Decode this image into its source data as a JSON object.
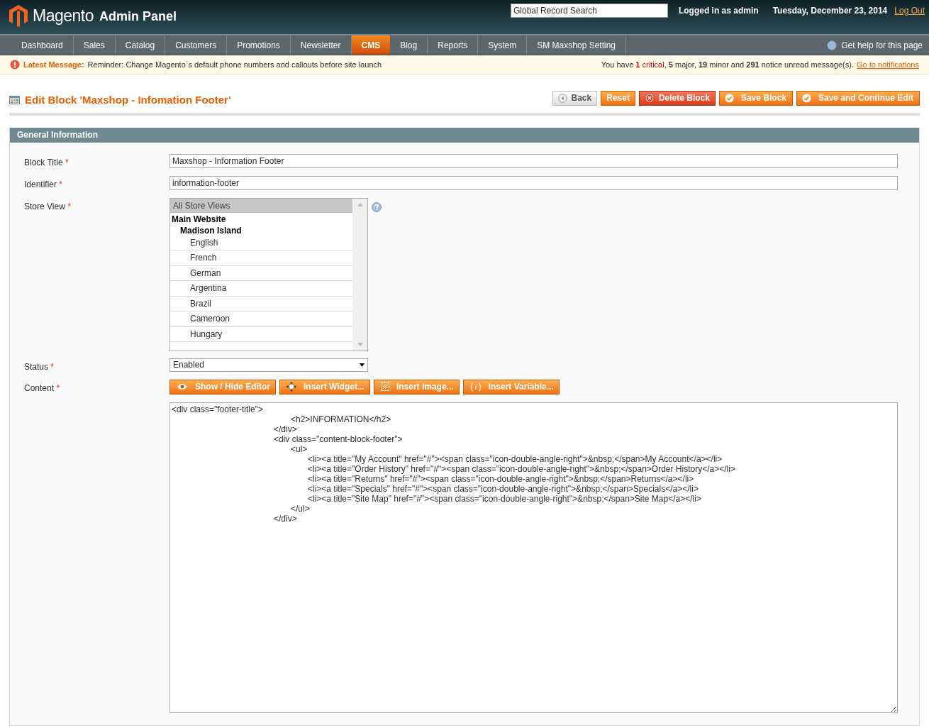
{
  "header": {
    "logo_text": "Magento",
    "logo_suffix": "Admin Panel",
    "search": {
      "placeholder": "Global Record Search"
    },
    "user_text": "Logged in as admin",
    "date": "Tuesday, December 23, 2014",
    "logout": "Log Out"
  },
  "nav": {
    "items": [
      {
        "label": "Dashboard",
        "selected": false
      },
      {
        "label": "Sales",
        "selected": false
      },
      {
        "label": "Catalog",
        "selected": false
      },
      {
        "label": "Customers",
        "selected": false
      },
      {
        "label": "Promotions",
        "selected": false
      },
      {
        "label": "Newsletter",
        "selected": false
      },
      {
        "label": "CMS",
        "selected": true
      },
      {
        "label": "Blog",
        "selected": false
      },
      {
        "label": "Reports",
        "selected": false
      },
      {
        "label": "System",
        "selected": false
      },
      {
        "label": "SM Maxshop Setting",
        "selected": false
      }
    ],
    "help": "Get help for this page"
  },
  "notice": {
    "label": "Latest Message:",
    "message": "Reminder: Change Magento`s default phone numbers and callouts before site launch",
    "summary_prefix": "You have ",
    "summary_critical": "**1** critical",
    "summary_rest": ", **5** major, **19** minor and **291** notice unread message(s). ",
    "link": "Go to notifications"
  },
  "page": {
    "title": "Edit Block 'Maxshop - Infomation Footer'",
    "buttons": [
      {
        "label": "Back",
        "kind": "back"
      },
      {
        "label": "Reset",
        "kind": "plain"
      },
      {
        "label": "Delete Block",
        "kind": "delete"
      },
      {
        "label": "Save Block",
        "kind": "save"
      },
      {
        "label": "Save and Continue Edit",
        "kind": "save"
      }
    ]
  },
  "section": {
    "title": "General Information",
    "block_title": {
      "required_mark": "*",
      "label": "Block Title",
      "value": "Maxshop - Information Footer"
    },
    "identifier": {
      "required_mark": "*",
      "label": "Identifier",
      "value": "information-footer"
    },
    "store_view": {
      "required_mark": "*",
      "label": "Store View",
      "options": [
        {
          "label": "All Store Views",
          "selected": true
        }
      ],
      "websites": [
        {
          "label": "Main Website",
          "children": [
            {
              "label": "Madison Island",
              "children": [
                {
                  "label": "English",
                  "selected": false
                },
                {
                  "label": "French",
                  "selected": false
                },
                {
                  "label": "German",
                  "selected": false
                },
                {
                  "label": "Argentina",
                  "selected": false
                },
                {
                  "label": "Brazil",
                  "selected": false
                },
                {
                  "label": "Cameroon",
                  "selected": false
                },
                {
                  "label": "Hungary",
                  "selected": false
                }
              ]
            }
          ]
        }
      ]
    },
    "status": {
      "required_mark": "*",
      "label": "Status",
      "value": "Enabled"
    },
    "content": {
      "required_mark": "*",
      "label": "Content",
      "buttons": [
        {
          "label": "Show / Hide Editor",
          "kind": "eye"
        },
        {
          "label": "Insert Widget...",
          "kind": "widget"
        },
        {
          "label": "Insert Image...",
          "kind": "image"
        },
        {
          "label": "Insert Variable...",
          "kind": "variable"
        }
      ],
      "value": "<div class=\"footer-title\">\n\t\t\t\t\t\t\t<h2>INFORMATION</h2>\n\t\t\t\t\t\t</div>\n\t\t\t\t\t\t<div class=\"content-block-footer\">\n\t\t\t\t\t\t\t<ul>\n\t\t\t\t\t\t\t\t<li><a title=\"My Account\" href=\"#\"><span class=\"icon-double-angle-right\">&nbsp;</span>My Account</a></li>\n\t\t\t\t\t\t\t\t<li><a title=\"Order History\" href=\"#\"><span class=\"icon-double-angle-right\">&nbsp;</span>Order History</a></li>\n\t\t\t\t\t\t\t\t<li><a title=\"Returns\" href=\"#\"><span class=\"icon-double-angle-right\">&nbsp;</span>Returns</a></li>\n\t\t\t\t\t\t\t\t<li><a title=\"Specials\" href=\"#\"><span class=\"icon-double-angle-right\">&nbsp;</span>Specials</a></li>\n\t\t\t\t\t\t\t\t<li><a title=\"Site Map\" href=\"#\"><span class=\"icon-double-angle-right\">&nbsp;</span>Site Map</a></li>\n\t\t\t\t\t\t\t</ul>\n\t\t\t\t\t\t</div>"
    }
  }
}
